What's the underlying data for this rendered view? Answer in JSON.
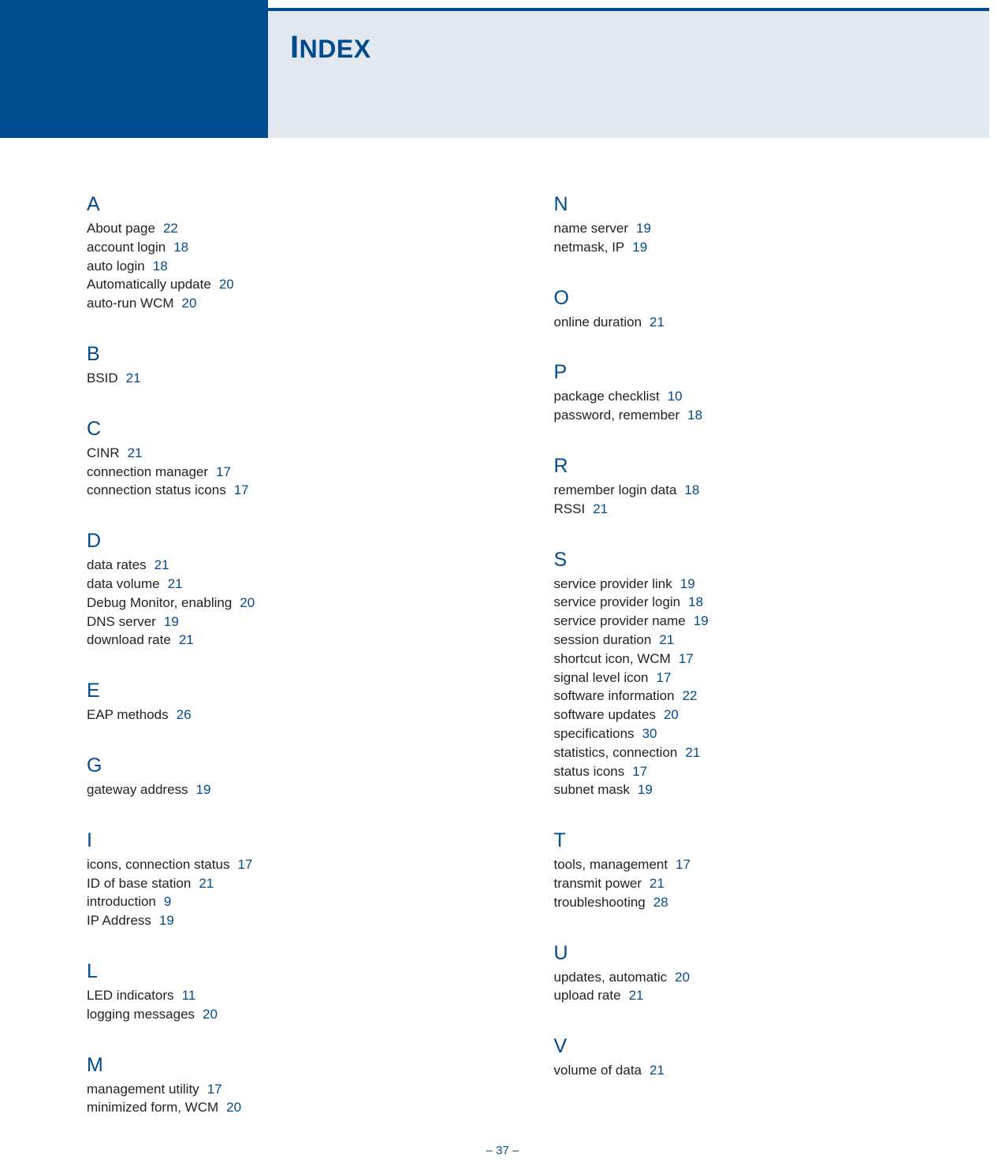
{
  "title_first": "I",
  "title_rest": "NDEX",
  "footer": "–  37  –",
  "columns": [
    [
      {
        "letter": "A",
        "entries": [
          {
            "text": "About page",
            "page": "22"
          },
          {
            "text": "account login",
            "page": "18"
          },
          {
            "text": "auto login",
            "page": "18"
          },
          {
            "text": "Automatically update",
            "page": "20"
          },
          {
            "text": "auto-run WCM",
            "page": "20"
          }
        ]
      },
      {
        "letter": "B",
        "entries": [
          {
            "text": "BSID",
            "page": "21"
          }
        ]
      },
      {
        "letter": "C",
        "entries": [
          {
            "text": "CINR",
            "page": "21"
          },
          {
            "text": "connection manager",
            "page": "17"
          },
          {
            "text": "connection status icons",
            "page": "17"
          }
        ]
      },
      {
        "letter": "D",
        "entries": [
          {
            "text": "data rates",
            "page": "21"
          },
          {
            "text": "data volume",
            "page": "21"
          },
          {
            "text": "Debug Monitor, enabling",
            "page": "20"
          },
          {
            "text": "DNS server",
            "page": "19"
          },
          {
            "text": "download rate",
            "page": "21"
          }
        ]
      },
      {
        "letter": "E",
        "entries": [
          {
            "text": "EAP methods",
            "page": "26"
          }
        ]
      },
      {
        "letter": "G",
        "entries": [
          {
            "text": "gateway address",
            "page": "19"
          }
        ]
      },
      {
        "letter": "I",
        "entries": [
          {
            "text": "icons, connection status",
            "page": "17"
          },
          {
            "text": "ID of base station",
            "page": "21"
          },
          {
            "text": "introduction",
            "page": "9"
          },
          {
            "text": "IP Address",
            "page": "19"
          }
        ]
      },
      {
        "letter": "L",
        "entries": [
          {
            "text": "LED indicators",
            "page": "11"
          },
          {
            "text": "logging messages",
            "page": "20"
          }
        ]
      },
      {
        "letter": "M",
        "entries": [
          {
            "text": "management utility",
            "page": "17"
          },
          {
            "text": "minimized form, WCM",
            "page": "20"
          }
        ]
      }
    ],
    [
      {
        "letter": "N",
        "entries": [
          {
            "text": "name server",
            "page": "19"
          },
          {
            "text": "netmask, IP",
            "page": "19"
          }
        ]
      },
      {
        "letter": "O",
        "entries": [
          {
            "text": "online duration",
            "page": "21"
          }
        ]
      },
      {
        "letter": "P",
        "entries": [
          {
            "text": "package checklist",
            "page": "10"
          },
          {
            "text": "password, remember",
            "page": "18"
          }
        ]
      },
      {
        "letter": "R",
        "entries": [
          {
            "text": "remember login data",
            "page": "18"
          },
          {
            "text": "RSSI",
            "page": "21"
          }
        ]
      },
      {
        "letter": "S",
        "entries": [
          {
            "text": "service provider link",
            "page": "19"
          },
          {
            "text": "service provider login",
            "page": "18"
          },
          {
            "text": "service provider name",
            "page": "19"
          },
          {
            "text": "session duration",
            "page": "21"
          },
          {
            "text": "shortcut icon, WCM",
            "page": "17"
          },
          {
            "text": "signal level icon",
            "page": "17"
          },
          {
            "text": "software information",
            "page": "22"
          },
          {
            "text": "software updates",
            "page": "20"
          },
          {
            "text": "specifications",
            "page": "30"
          },
          {
            "text": "statistics, connection",
            "page": "21"
          },
          {
            "text": "status icons",
            "page": "17"
          },
          {
            "text": "subnet mask",
            "page": "19"
          }
        ]
      },
      {
        "letter": "T",
        "entries": [
          {
            "text": "tools, management",
            "page": "17"
          },
          {
            "text": "transmit power",
            "page": "21"
          },
          {
            "text": "troubleshooting",
            "page": "28"
          }
        ]
      },
      {
        "letter": "U",
        "entries": [
          {
            "text": "updates, automatic",
            "page": "20"
          },
          {
            "text": "upload rate",
            "page": "21"
          }
        ]
      },
      {
        "letter": "V",
        "entries": [
          {
            "text": "volume of data",
            "page": "21"
          }
        ]
      }
    ]
  ]
}
